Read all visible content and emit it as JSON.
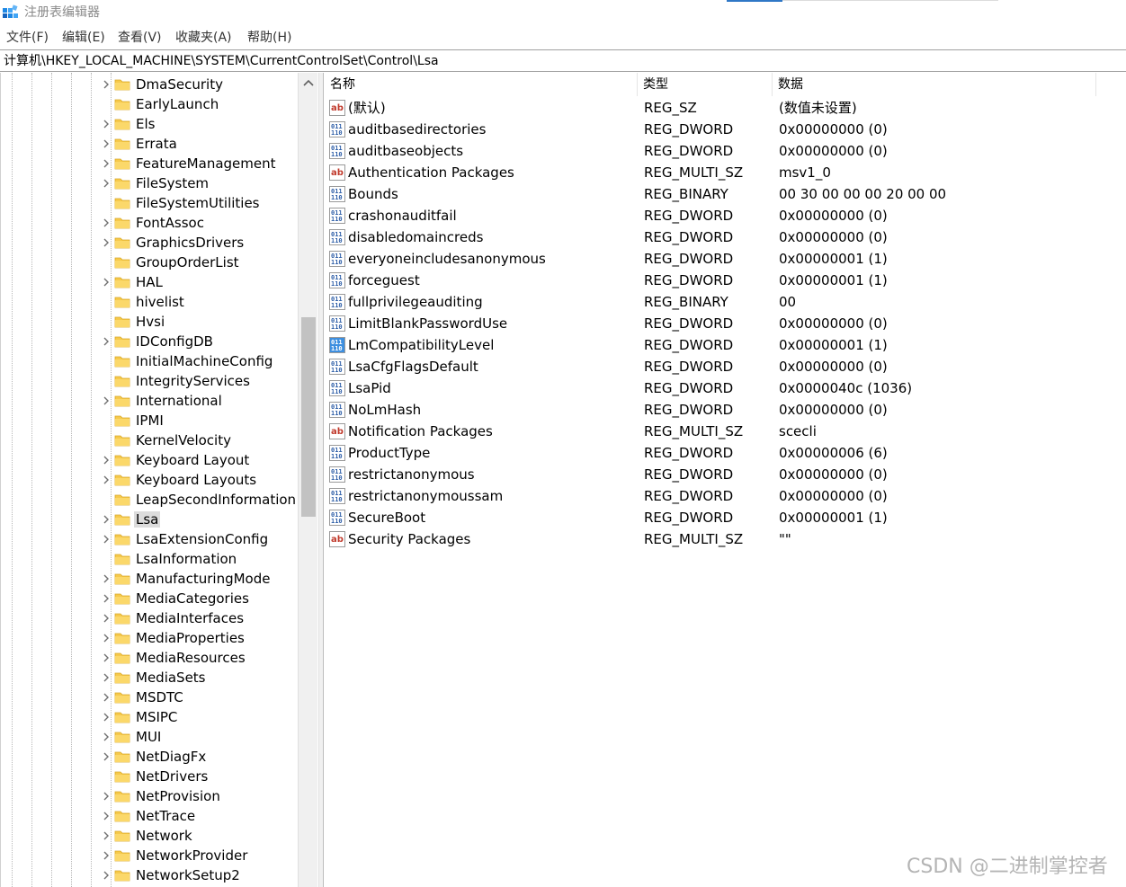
{
  "window": {
    "title": "注册表编辑器",
    "accent_color": "#2f77c6"
  },
  "menu": [
    {
      "label": "文件(F)"
    },
    {
      "label": "编辑(E)"
    },
    {
      "label": "查看(V)"
    },
    {
      "label": "收藏夹(A)"
    },
    {
      "label": "帮助(H)"
    }
  ],
  "address": {
    "path": "计算机\\HKEY_LOCAL_MACHINE\\SYSTEM\\CurrentControlSet\\Control\\Lsa"
  },
  "tree": {
    "items": [
      {
        "label": "DmaSecurity",
        "expandable": true
      },
      {
        "label": "EarlyLaunch",
        "expandable": false
      },
      {
        "label": "Els",
        "expandable": true
      },
      {
        "label": "Errata",
        "expandable": true
      },
      {
        "label": "FeatureManagement",
        "expandable": true
      },
      {
        "label": "FileSystem",
        "expandable": true
      },
      {
        "label": "FileSystemUtilities",
        "expandable": false
      },
      {
        "label": "FontAssoc",
        "expandable": true
      },
      {
        "label": "GraphicsDrivers",
        "expandable": true
      },
      {
        "label": "GroupOrderList",
        "expandable": false
      },
      {
        "label": "HAL",
        "expandable": true
      },
      {
        "label": "hivelist",
        "expandable": false
      },
      {
        "label": "Hvsi",
        "expandable": false
      },
      {
        "label": "IDConfigDB",
        "expandable": true
      },
      {
        "label": "InitialMachineConfig",
        "expandable": false
      },
      {
        "label": "IntegrityServices",
        "expandable": false
      },
      {
        "label": "International",
        "expandable": true
      },
      {
        "label": "IPMI",
        "expandable": false
      },
      {
        "label": "KernelVelocity",
        "expandable": false
      },
      {
        "label": "Keyboard Layout",
        "expandable": true
      },
      {
        "label": "Keyboard Layouts",
        "expandable": true
      },
      {
        "label": "LeapSecondInformation",
        "expandable": false
      },
      {
        "label": "Lsa",
        "expandable": true,
        "selected": true
      },
      {
        "label": "LsaExtensionConfig",
        "expandable": true
      },
      {
        "label": "LsaInformation",
        "expandable": false
      },
      {
        "label": "ManufacturingMode",
        "expandable": true
      },
      {
        "label": "MediaCategories",
        "expandable": true
      },
      {
        "label": "MediaInterfaces",
        "expandable": true
      },
      {
        "label": "MediaProperties",
        "expandable": true
      },
      {
        "label": "MediaResources",
        "expandable": true
      },
      {
        "label": "MediaSets",
        "expandable": true
      },
      {
        "label": "MSDTC",
        "expandable": true
      },
      {
        "label": "MSIPC",
        "expandable": true
      },
      {
        "label": "MUI",
        "expandable": true
      },
      {
        "label": "NetDiagFx",
        "expandable": true
      },
      {
        "label": "NetDrivers",
        "expandable": false
      },
      {
        "label": "NetProvision",
        "expandable": true
      },
      {
        "label": "NetTrace",
        "expandable": true
      },
      {
        "label": "Network",
        "expandable": true
      },
      {
        "label": "NetworkProvider",
        "expandable": true
      },
      {
        "label": "NetworkSetup2",
        "expandable": true
      }
    ]
  },
  "list": {
    "columns": [
      "名称",
      "类型",
      "数据"
    ],
    "rows": [
      {
        "icon": "string-value-icon",
        "name": "(默认)",
        "type": "REG_SZ",
        "data": "(数值未设置)"
      },
      {
        "icon": "binary-value-icon",
        "name": "auditbasedirectories",
        "type": "REG_DWORD",
        "data": "0x00000000 (0)"
      },
      {
        "icon": "binary-value-icon",
        "name": "auditbaseobjects",
        "type": "REG_DWORD",
        "data": "0x00000000 (0)"
      },
      {
        "icon": "string-value-icon",
        "name": "Authentication Packages",
        "type": "REG_MULTI_SZ",
        "data": "msv1_0"
      },
      {
        "icon": "binary-value-icon",
        "name": "Bounds",
        "type": "REG_BINARY",
        "data": "00 30 00 00 00 20 00 00"
      },
      {
        "icon": "binary-value-icon",
        "name": "crashonauditfail",
        "type": "REG_DWORD",
        "data": "0x00000000 (0)"
      },
      {
        "icon": "binary-value-icon",
        "name": "disabledomaincreds",
        "type": "REG_DWORD",
        "data": "0x00000000 (0)"
      },
      {
        "icon": "binary-value-icon",
        "name": "everyoneincludesanonymous",
        "type": "REG_DWORD",
        "data": "0x00000001 (1)"
      },
      {
        "icon": "binary-value-icon",
        "name": "forceguest",
        "type": "REG_DWORD",
        "data": "0x00000001 (1)"
      },
      {
        "icon": "binary-value-icon",
        "name": "fullprivilegeauditing",
        "type": "REG_BINARY",
        "data": "00"
      },
      {
        "icon": "binary-value-icon",
        "name": "LimitBlankPasswordUse",
        "type": "REG_DWORD",
        "data": "0x00000000 (0)"
      },
      {
        "icon": "binary-value-icon",
        "name": "LmCompatibilityLevel",
        "type": "REG_DWORD",
        "data": "0x00000001 (1)",
        "highlight": true
      },
      {
        "icon": "binary-value-icon",
        "name": "LsaCfgFlagsDefault",
        "type": "REG_DWORD",
        "data": "0x00000000 (0)"
      },
      {
        "icon": "binary-value-icon",
        "name": "LsaPid",
        "type": "REG_DWORD",
        "data": "0x0000040c (1036)"
      },
      {
        "icon": "binary-value-icon",
        "name": "NoLmHash",
        "type": "REG_DWORD",
        "data": "0x00000000 (0)"
      },
      {
        "icon": "string-value-icon",
        "name": "Notification Packages",
        "type": "REG_MULTI_SZ",
        "data": "scecli"
      },
      {
        "icon": "binary-value-icon",
        "name": "ProductType",
        "type": "REG_DWORD",
        "data": "0x00000006 (6)"
      },
      {
        "icon": "binary-value-icon",
        "name": "restrictanonymous",
        "type": "REG_DWORD",
        "data": "0x00000000 (0)"
      },
      {
        "icon": "binary-value-icon",
        "name": "restrictanonymoussam",
        "type": "REG_DWORD",
        "data": "0x00000000 (0)"
      },
      {
        "icon": "binary-value-icon",
        "name": "SecureBoot",
        "type": "REG_DWORD",
        "data": "0x00000001 (1)"
      },
      {
        "icon": "string-value-icon",
        "name": "Security Packages",
        "type": "REG_MULTI_SZ",
        "data": "\"\""
      }
    ]
  },
  "watermark": "CSDN @二进制掌控者"
}
